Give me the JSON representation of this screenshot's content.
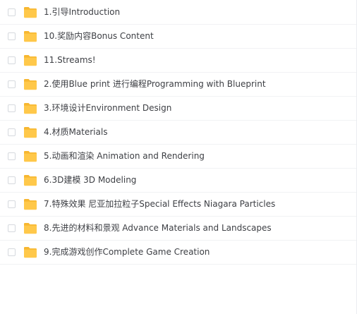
{
  "colors": {
    "folder_fill": "#FFC84A",
    "folder_tab": "#F7B731",
    "row_divider": "#F1F2F4"
  },
  "file_list": {
    "items": [
      {
        "name": "1.引导Introduction",
        "icon": "folder-icon"
      },
      {
        "name": "10.奖励内容Bonus Content",
        "icon": "folder-icon"
      },
      {
        "name": "11.Streams!",
        "icon": "folder-icon"
      },
      {
        "name": "2.使用Blue print 进行编程Programming with Blueprint",
        "icon": "folder-icon"
      },
      {
        "name": "3.环境设计Environment Design",
        "icon": "folder-icon"
      },
      {
        "name": "4.材质Materials",
        "icon": "folder-icon"
      },
      {
        "name": "5.动画和渲染 Animation and Rendering",
        "icon": "folder-icon"
      },
      {
        "name": "6.3D建模 3D Modeling",
        "icon": "folder-icon"
      },
      {
        "name": "7.特殊效果 尼亚加拉粒子Special Effects Niagara Particles",
        "icon": "folder-icon"
      },
      {
        "name": "8.先进的材料和景观 Advance Materials and Landscapes",
        "icon": "folder-icon"
      },
      {
        "name": "9.完成游戏创作Complete Game Creation",
        "icon": "folder-icon"
      }
    ]
  }
}
